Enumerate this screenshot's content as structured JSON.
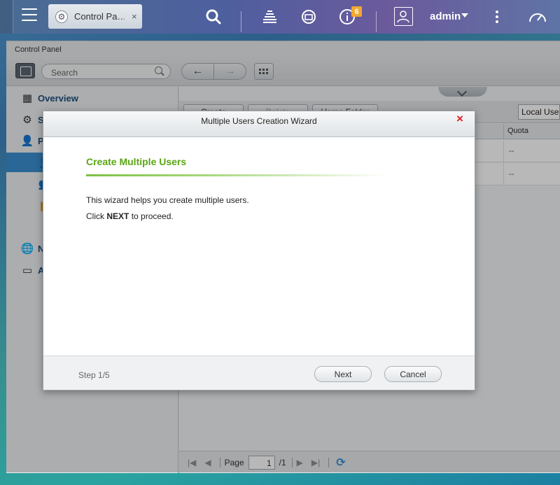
{
  "topbar": {
    "tab_label": "Control Pa…",
    "tab_close": "×",
    "notification_count": "6",
    "username": "admin"
  },
  "window": {
    "title": "Control Panel",
    "search_placeholder": "Search",
    "back_arrow": "←",
    "forward_arrow": "→"
  },
  "sidebar": {
    "items": [
      {
        "label": "Overview",
        "icon": "overview-icon"
      },
      {
        "label": "S",
        "icon": "gear-icon"
      },
      {
        "label": "P",
        "icon": "user-icon"
      },
      {
        "label": "",
        "icon": "user-icon"
      },
      {
        "label": "",
        "icon": "user-group-icon"
      },
      {
        "label": "",
        "icon": "folder-icon"
      },
      {
        "label": "",
        "icon": "quota-icon"
      },
      {
        "label": "N",
        "icon": "globe-icon"
      },
      {
        "label": "A",
        "icon": "inbox-icon"
      }
    ]
  },
  "content": {
    "toolbar": {
      "create_label": "Create",
      "delete_label": "Delete",
      "home_folder_label": "Home Folder",
      "filter_value": "Local Users"
    },
    "columns": {
      "quota": "Quota"
    },
    "rows": [
      {
        "quota": "--"
      },
      {
        "quota": "--"
      }
    ],
    "pager": {
      "page_label": "Page",
      "page_value": "1",
      "total_pages": "/1"
    }
  },
  "modal": {
    "title": "Multiple Users Creation Wizard",
    "close": "×",
    "heading": "Create Multiple Users",
    "line1": "This wizard helps you create multiple users.",
    "line2_prefix": "Click ",
    "line2_bold": "NEXT",
    "line2_suffix": " to proceed.",
    "step": "Step 1/5",
    "next_label": "Next",
    "cancel_label": "Cancel"
  },
  "colors": {
    "accent_green": "#5aa612",
    "close_red": "#e01d1d",
    "selected_blue": "#3b8fd0",
    "badge_orange": "#f0a830"
  }
}
